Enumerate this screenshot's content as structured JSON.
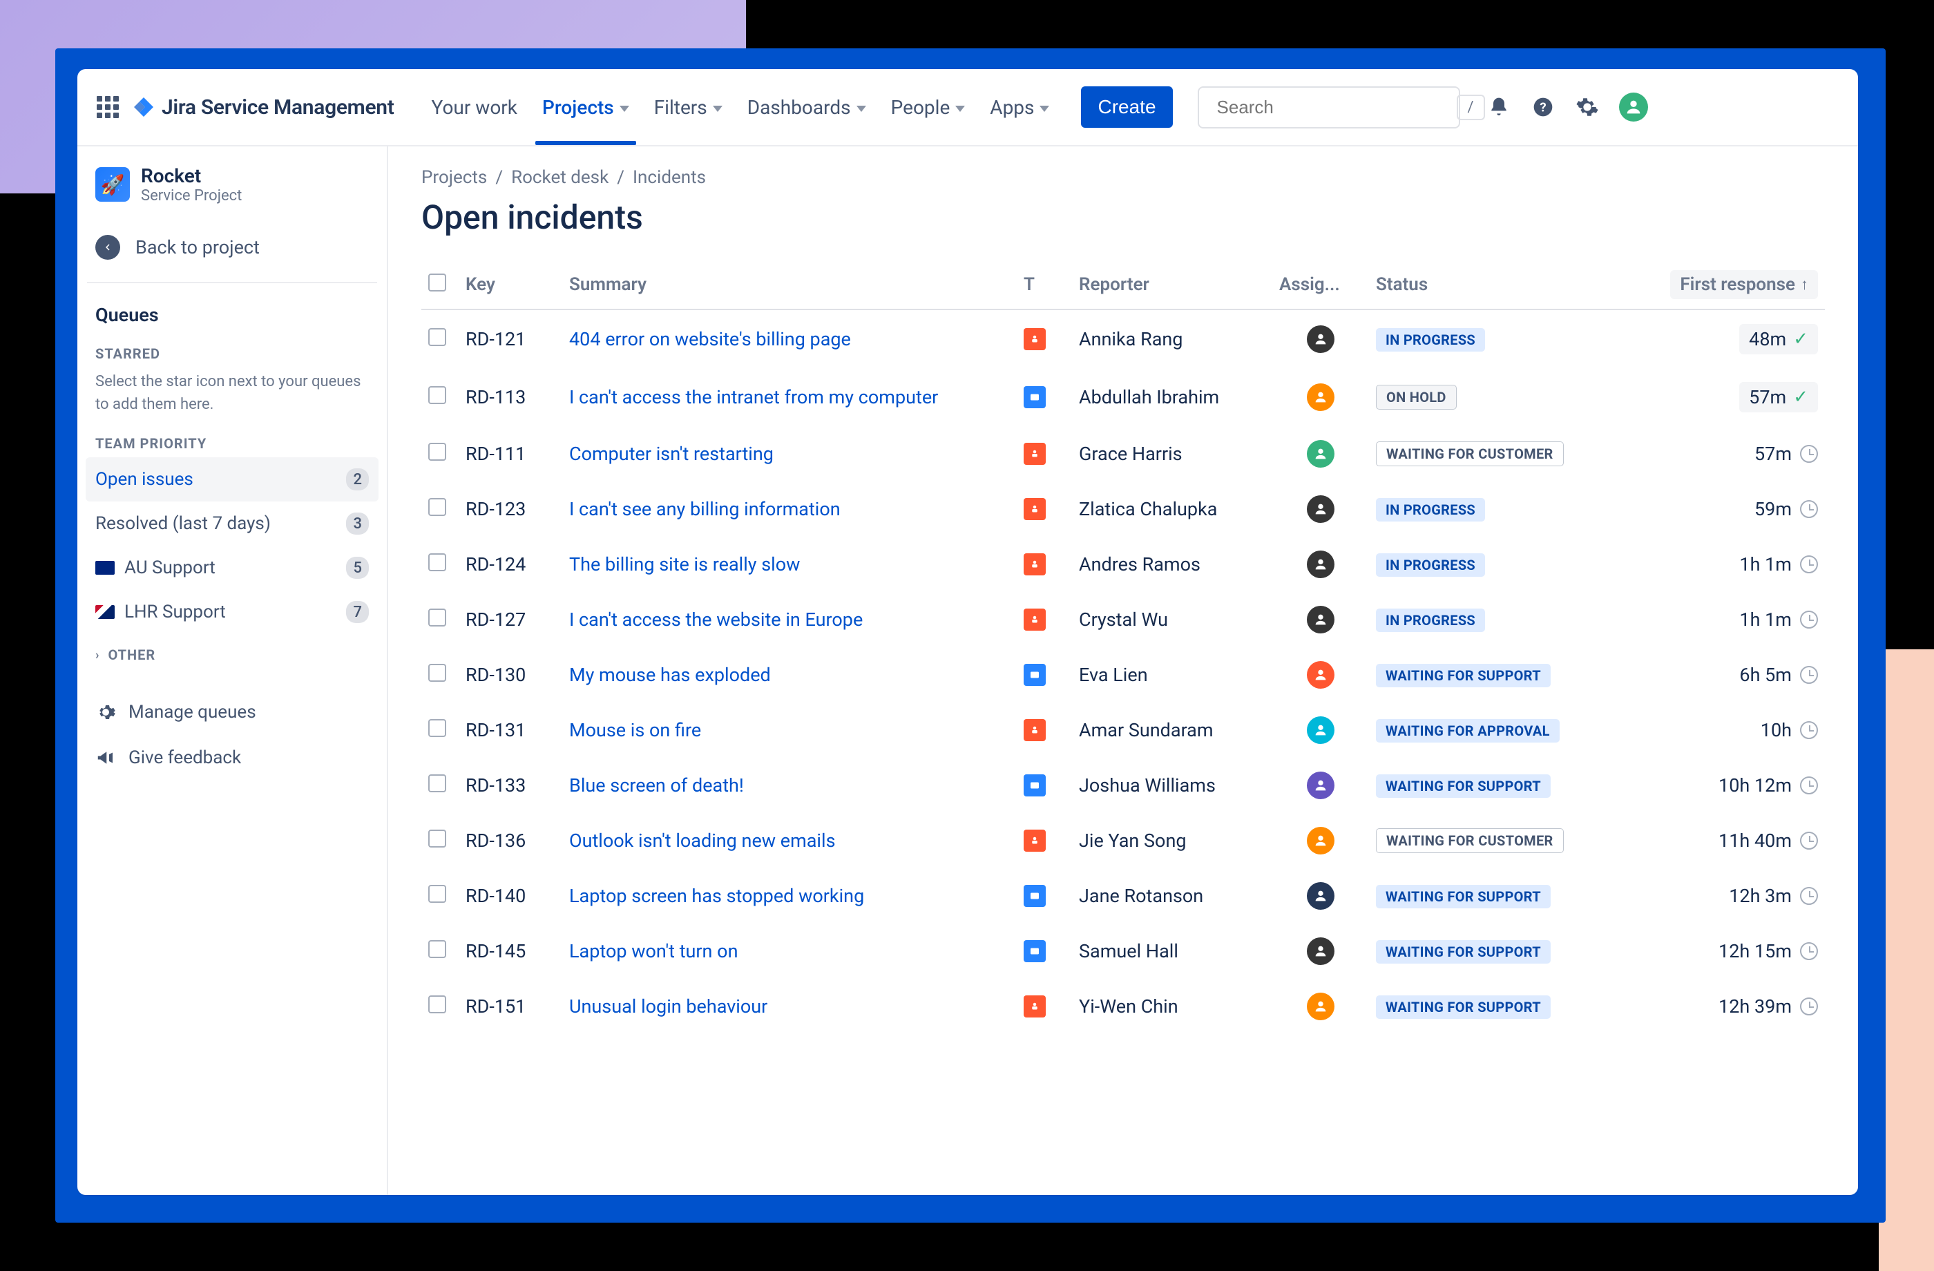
{
  "topnav": {
    "product": "Jira Service Management",
    "items": [
      "Your work",
      "Projects",
      "Filters",
      "Dashboards",
      "People",
      "Apps"
    ],
    "active_index": 1,
    "create": "Create",
    "search_placeholder": "Search",
    "kbd": "/"
  },
  "sidebar": {
    "project_name": "Rocket",
    "project_type": "Service Project",
    "back": "Back to project",
    "queues_heading": "Queues",
    "starred_label": "STARRED",
    "starred_help": "Select the star icon next to your queues to add them here.",
    "team_label": "TEAM PRIORITY",
    "items": [
      {
        "label": "Open issues",
        "count": "2",
        "active": true,
        "flag": ""
      },
      {
        "label": "Resolved (last 7 days)",
        "count": "3",
        "active": false,
        "flag": ""
      },
      {
        "label": "AU Support",
        "count": "5",
        "active": false,
        "flag": "au"
      },
      {
        "label": "LHR Support",
        "count": "7",
        "active": false,
        "flag": "gb"
      }
    ],
    "other_label": "OTHER",
    "manage": "Manage queues",
    "feedback": "Give feedback"
  },
  "breadcrumb": [
    "Projects",
    "Rocket desk",
    "Incidents"
  ],
  "page_title": "Open incidents",
  "columns": {
    "key": "Key",
    "summary": "Summary",
    "t": "T",
    "reporter": "Reporter",
    "assignee": "Assig...",
    "status": "Status",
    "first_response": "First response"
  },
  "rows": [
    {
      "key": "RD-121",
      "summary": "404 error on website's billing page",
      "type": "orange",
      "reporter": "Annika Rang",
      "assign": "bw",
      "status": "IN PROGRESS",
      "status_class": "st-inprogress",
      "fr": "48m",
      "fr_style": "chip-check"
    },
    {
      "key": "RD-113",
      "summary": "I can't access the intranet from my computer",
      "type": "blue",
      "reporter": "Abdullah Ibrahim",
      "assign": "c1",
      "status": "ON HOLD",
      "status_class": "st-onhold",
      "fr": "57m",
      "fr_style": "chip-check"
    },
    {
      "key": "RD-111",
      "summary": "Computer isn't restarting",
      "type": "orange",
      "reporter": "Grace Harris",
      "assign": "c2",
      "status": "WAITING FOR CUSTOMER",
      "status_class": "st-waitcust",
      "fr": "57m",
      "fr_style": "clock"
    },
    {
      "key": "RD-123",
      "summary": "I can't see any billing information",
      "type": "orange",
      "reporter": "Zlatica Chalupka",
      "assign": "bw",
      "status": "IN PROGRESS",
      "status_class": "st-inprogress",
      "fr": "59m",
      "fr_style": "clock"
    },
    {
      "key": "RD-124",
      "summary": "The billing site is really slow",
      "type": "orange",
      "reporter": "Andres Ramos",
      "assign": "bw",
      "status": "IN PROGRESS",
      "status_class": "st-inprogress",
      "fr": "1h 1m",
      "fr_style": "clock"
    },
    {
      "key": "RD-127",
      "summary": "I can't access the website in Europe",
      "type": "orange",
      "reporter": "Crystal Wu",
      "assign": "bw",
      "status": "IN PROGRESS",
      "status_class": "st-inprogress",
      "fr": "1h 1m",
      "fr_style": "clock"
    },
    {
      "key": "RD-130",
      "summary": "My mouse has exploded",
      "type": "blue",
      "reporter": "Eva Lien",
      "assign": "c5",
      "status": "WAITING FOR SUPPORT",
      "status_class": "st-waitsupp",
      "fr": "6h 5m",
      "fr_style": "clock"
    },
    {
      "key": "RD-131",
      "summary": "Mouse is on fire",
      "type": "orange",
      "reporter": "Amar Sundaram",
      "assign": "c3",
      "status": "WAITING FOR APPROVAL",
      "status_class": "st-waitapp",
      "fr": "10h",
      "fr_style": "clock"
    },
    {
      "key": "RD-133",
      "summary": "Blue screen of death!",
      "type": "blue",
      "reporter": "Joshua Williams",
      "assign": "c4",
      "status": "WAITING FOR SUPPORT",
      "status_class": "st-waitsupp",
      "fr": "10h 12m",
      "fr_style": "clock"
    },
    {
      "key": "RD-136",
      "summary": "Outlook isn't loading new emails",
      "type": "orange",
      "reporter": "Jie Yan Song",
      "assign": "c1",
      "status": "WAITING FOR CUSTOMER",
      "status_class": "st-waitcust",
      "fr": "11h 40m",
      "fr_style": "clock"
    },
    {
      "key": "RD-140",
      "summary": "Laptop screen has stopped working",
      "type": "blue",
      "reporter": "Jane Rotanson",
      "assign": "c6",
      "status": "WAITING FOR SUPPORT",
      "status_class": "st-waitsupp",
      "fr": "12h 3m",
      "fr_style": "clock"
    },
    {
      "key": "RD-145",
      "summary": "Laptop won't turn on",
      "type": "blue",
      "reporter": "Samuel Hall",
      "assign": "bw",
      "status": "WAITING FOR SUPPORT",
      "status_class": "st-waitsupp",
      "fr": "12h 15m",
      "fr_style": "clock"
    },
    {
      "key": "RD-151",
      "summary": "Unusual login behaviour",
      "type": "orange",
      "reporter": "Yi-Wen Chin",
      "assign": "c1",
      "status": "WAITING FOR SUPPORT",
      "status_class": "st-waitsupp",
      "fr": "12h 39m",
      "fr_style": "clock"
    }
  ]
}
